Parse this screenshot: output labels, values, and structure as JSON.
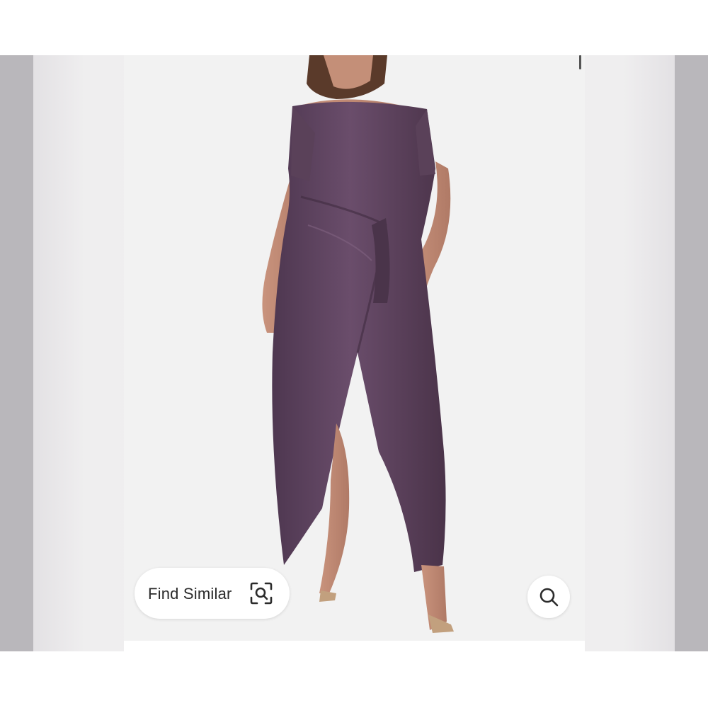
{
  "find_similar": {
    "label": "Find Similar",
    "icon": "scan-search-icon"
  },
  "search_button": {
    "icon": "search-icon"
  },
  "product_image": {
    "icon": "product-photo",
    "dress_color": "#5e4460",
    "background_color": "#f2f2f2"
  }
}
